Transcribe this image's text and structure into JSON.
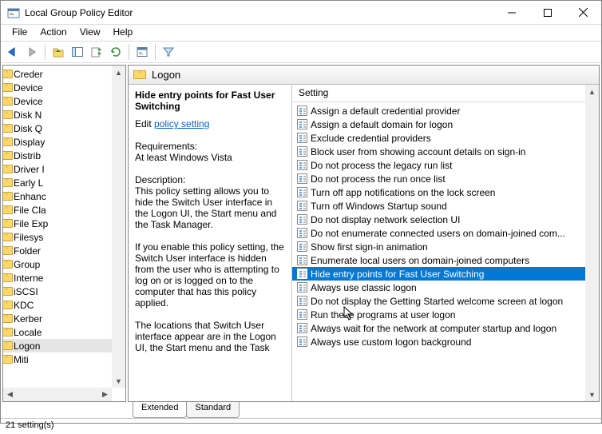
{
  "window": {
    "title": "Local Group Policy Editor"
  },
  "menu": {
    "file": "File",
    "action": "Action",
    "view": "View",
    "help": "Help"
  },
  "tree": {
    "items": [
      {
        "label": "Creder",
        "arr": ""
      },
      {
        "label": "Device",
        "arr": ""
      },
      {
        "label": "Device",
        "arr": ">"
      },
      {
        "label": "Disk N",
        "arr": ">"
      },
      {
        "label": "Disk Q",
        "arr": ">"
      },
      {
        "label": "Display",
        "arr": ">"
      },
      {
        "label": "Distrib",
        "arr": ""
      },
      {
        "label": "Driver I",
        "arr": ""
      },
      {
        "label": "Early L",
        "arr": ""
      },
      {
        "label": "Enhanc",
        "arr": ""
      },
      {
        "label": "File Cla",
        "arr": ""
      },
      {
        "label": "File Exp",
        "arr": ">"
      },
      {
        "label": "Filesys",
        "arr": ">"
      },
      {
        "label": "Folder",
        "arr": ""
      },
      {
        "label": "Group",
        "arr": ">"
      },
      {
        "label": "Interne",
        "arr": ">"
      },
      {
        "label": "iSCSI",
        "arr": ">"
      },
      {
        "label": "KDC",
        "arr": ""
      },
      {
        "label": "Kerber",
        "arr": ""
      },
      {
        "label": "Locale",
        "arr": ""
      },
      {
        "label": "Logon",
        "arr": ""
      },
      {
        "label": "Miti",
        "arr": ">"
      }
    ],
    "selectedIndex": 20
  },
  "crumb": {
    "label": "Logon"
  },
  "detail": {
    "name": "Hide entry points for Fast User Switching",
    "editPrefix": "Edit ",
    "editLink": "policy setting ",
    "reqHeading": "Requirements:",
    "reqBody": "At least Windows Vista",
    "descHeading": "Description:",
    "descBody1": "This policy setting allows you to hide the Switch User interface in the Logon UI, the Start menu and the Task Manager.",
    "descBody2": "If you enable this policy setting, the Switch User interface is hidden from the user who is attempting to log on or is logged on to the computer that has this policy applied.",
    "descBody3": "The locations that Switch User interface appear are in the Logon UI, the Start menu and the Task"
  },
  "list": {
    "header": "Setting",
    "items": [
      "Assign a default credential provider",
      "Assign a default domain for logon",
      "Exclude credential providers",
      "Block user from showing account details on sign-in",
      "Do not process the legacy run list",
      "Do not process the run once list",
      "Turn off app notifications on the lock screen",
      "Turn off Windows Startup sound",
      "Do not display network selection UI",
      "Do not enumerate connected users on domain-joined com...",
      "Show first sign-in animation",
      "Enumerate local users on domain-joined computers",
      "Hide entry points for Fast User Switching",
      "Always use classic logon",
      "Do not display the Getting Started welcome screen at logon",
      "Run these programs at user logon",
      "Always wait for the network at computer startup and logon",
      "Always use custom logon background"
    ],
    "selectedIndex": 12
  },
  "tabs": {
    "extended": "Extended",
    "standard": "Standard"
  },
  "status": {
    "text": "21 setting(s)"
  }
}
